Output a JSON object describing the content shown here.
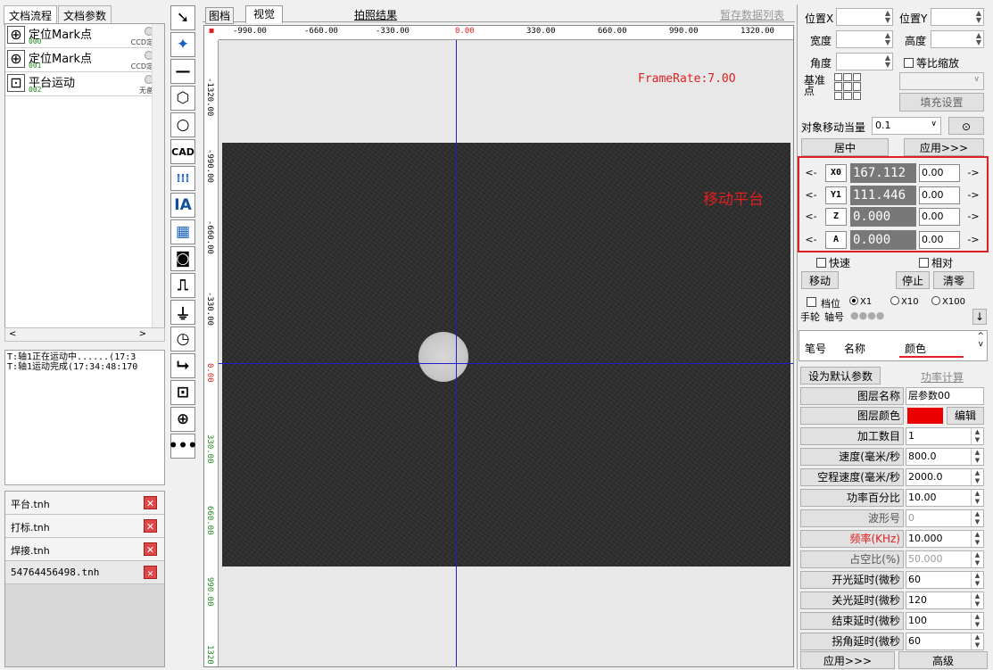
{
  "left_tabs": {
    "flow": "文档流程",
    "params": "文档参数"
  },
  "flow_items": [
    {
      "name": "定位Mark点",
      "id": "000",
      "tag": "CCD定位",
      "icon": "⊕"
    },
    {
      "name": "定位Mark点",
      "id": "001",
      "tag": "CCD定位",
      "icon": "⊕"
    },
    {
      "name": "平台运动",
      "id": "002",
      "tag": "无备注",
      "icon": "⊡"
    }
  ],
  "log": {
    "line1": "T:轴1正在运动中......(17:3",
    "line2": "T:轴1运动完成(17:34:48:170"
  },
  "files": [
    "平台.tnh",
    "打标.tnh",
    "焊接.tnh",
    "54764456498.tnh"
  ],
  "view_tabs": {
    "drawing": "图档",
    "vision": "视觉",
    "results": "拍照结果",
    "temp": "暂存数据列表"
  },
  "ruler": {
    "h": [
      "-990.00",
      "-660.00",
      "-330.00",
      "0.00",
      "330.00",
      "660.00",
      "990.00",
      "1320.00"
    ],
    "v": [
      "-1320.00",
      "-990.00",
      "-660.00",
      "-330.00",
      "0.00",
      "330.00",
      "660.00",
      "990.00",
      "1320"
    ]
  },
  "camera": {
    "frame_rate": "FrameRate:7.0O",
    "overlay_label": "移动平台"
  },
  "props": {
    "pos_x": "位置X",
    "pos_y": "位置Y",
    "width": "宽度",
    "height": "高度",
    "angle": "角度",
    "keep_ratio": "等比缩放",
    "base_point": "基准点",
    "fill_settings": "填充设置",
    "move_unit_label": "对象移动当量",
    "move_unit": "0.1",
    "center": "居中",
    "apply": "应用>>>"
  },
  "axes": [
    {
      "name": "X0",
      "value": "167.112",
      "step": "0.00"
    },
    {
      "name": "Y1",
      "value": "111.446",
      "step": "0.00"
    },
    {
      "name": "Z",
      "value": "0.000",
      "step": "0.00"
    },
    {
      "name": "A",
      "value": "0.000",
      "step": "0.00"
    }
  ],
  "motion": {
    "fast": "快速",
    "relative": "相对",
    "move": "移动",
    "stop": "停止",
    "zero": "清零",
    "handwheel": "手轮",
    "gear": "档位",
    "x1": "X1",
    "x10": "X10",
    "x100": "X100",
    "axis_no": "轴号"
  },
  "pen_table": {
    "pen": "笔号",
    "name": "名称",
    "color": "颜色"
  },
  "layer": {
    "default_btn": "设为默认参数>>>",
    "power_calc": "功率计算",
    "rows": [
      {
        "label": "图层名称",
        "value": "层参数00"
      },
      {
        "label": "图层颜色",
        "value": "编辑"
      },
      {
        "label": "加工数目",
        "value": "1"
      },
      {
        "label": "速度(毫米/秒",
        "value": "800.0"
      },
      {
        "label": "空程速度(毫米/秒",
        "value": "2000.0"
      },
      {
        "label": "功率百分比",
        "value": "10.00"
      },
      {
        "label": "波形号",
        "value": "0"
      },
      {
        "label": "频率(KHz)",
        "value": "10.000"
      },
      {
        "label": "占空比(%)",
        "value": "50.000"
      },
      {
        "label": "开光延时(微秒",
        "value": "60"
      },
      {
        "label": "关光延时(微秒",
        "value": "120"
      },
      {
        "label": "结束延时(微秒",
        "value": "100"
      },
      {
        "label": "拐角延时(微秒",
        "value": "60"
      }
    ],
    "apply": "应用>>>",
    "advanced": "高级"
  },
  "colors": {
    "accent_red": "#e02020",
    "cross": "#1f1fcf",
    "layer_color": "#ee0000"
  }
}
